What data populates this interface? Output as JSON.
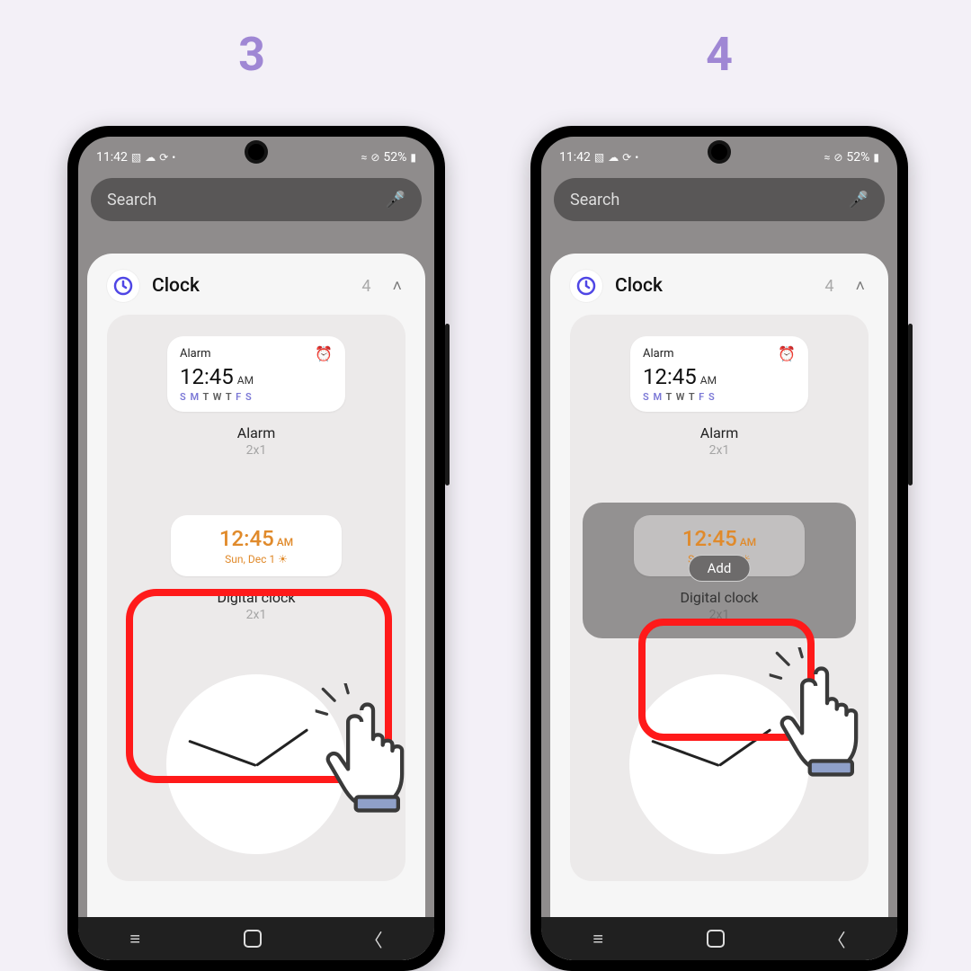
{
  "steps": {
    "s3": "3",
    "s4": "4"
  },
  "status": {
    "time": "11:42",
    "battery": "52%",
    "net": "⊘"
  },
  "search": {
    "placeholder": "Search"
  },
  "sheet": {
    "title": "Clock",
    "count": "4"
  },
  "widgets": {
    "alarm": {
      "label": "Alarm",
      "time": "12:45",
      "ampm": "AM",
      "days_html": "S M T W T F S",
      "name": "Alarm",
      "size": "2x1"
    },
    "digital": {
      "time": "12:45",
      "ampm": "AM",
      "date": "Sun, Dec 1 ☀",
      "name": "Digital clock",
      "size": "2x1",
      "add": "Add"
    }
  }
}
